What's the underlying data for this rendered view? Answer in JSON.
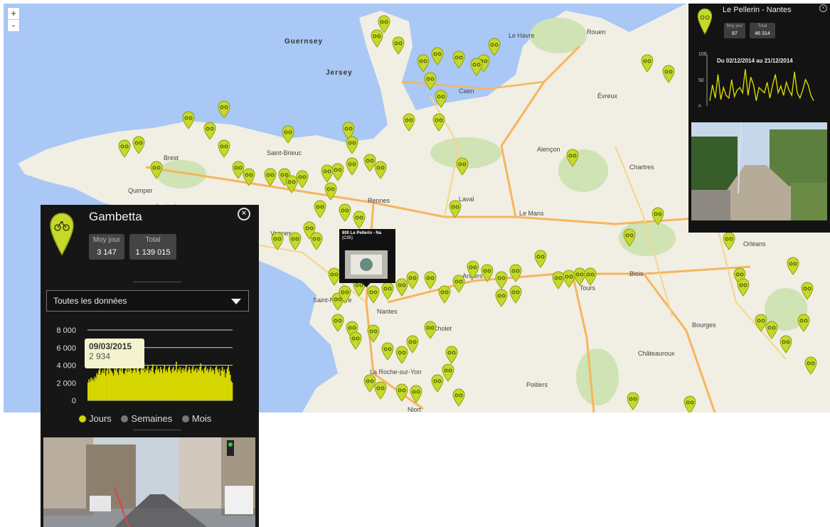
{
  "map": {
    "zoom_in": "+",
    "zoom_out": "-",
    "seas": [
      "Guernsey",
      "Jersey"
    ],
    "places": [
      "Le Havre",
      "Rouen",
      "Caen",
      "Saint-Brieuc",
      "Rennes",
      "Le Mans",
      "Angers",
      "Tours",
      "Nantes",
      "Cholet",
      "La Roche-sur-Yon",
      "Poitiers",
      "Châteauroux",
      "Blois",
      "Orléans",
      "Bourges",
      "Lorient",
      "Vannes",
      "Quimper",
      "Brest",
      "Laval",
      "Évreux",
      "Saint-Nazaire",
      "Alençon",
      "Chartres",
      "Niort"
    ]
  },
  "popup": {
    "title": "800 Le Pellerin - Na",
    "subtitle": "(C95)"
  },
  "panel": {
    "title": "Gambetta",
    "stats": [
      {
        "label": "Moy jour",
        "value": "3 147"
      },
      {
        "label": "Total",
        "value": "1 139 015"
      }
    ],
    "select": "Toutes les données",
    "tooltip": {
      "date": "09/03/2015",
      "value": "2 934"
    },
    "periods": [
      {
        "label": "Jours",
        "selected": true
      },
      {
        "label": "Semaines",
        "selected": false
      },
      {
        "label": "Mois",
        "selected": false
      }
    ],
    "accent": "#d6d600"
  },
  "chart_data": [
    {
      "type": "bar",
      "title": "",
      "ylabel": "",
      "ylim": [
        0,
        8000
      ],
      "ytick_labels": [
        "8 000",
        "6 000",
        "4 000",
        "2 000",
        "0"
      ],
      "series": [
        {
          "values": [
            2000,
            2400,
            2100,
            2600,
            2300,
            2500,
            2200,
            2700,
            2500,
            3100,
            2900,
            3400,
            3800,
            2900,
            3200,
            3500,
            3100,
            3600,
            2800,
            3400,
            4200,
            3000,
            3700,
            3500,
            3300,
            3100,
            2800,
            3600,
            3400,
            3900,
            3200,
            2900,
            3500,
            3600,
            3300,
            3800,
            3100,
            3000,
            3400,
            3700,
            3200,
            3600,
            3300,
            4000,
            3500,
            3100,
            3400,
            3800,
            3500,
            3200,
            3600,
            3900,
            3300,
            3000,
            3500,
            3700,
            3400,
            4300,
            3200,
            3600,
            3400,
            3900,
            3100,
            3500,
            3300,
            3700,
            4100,
            3200,
            3000,
            3500,
            3900,
            3400,
            3600,
            3200,
            3800,
            3500,
            3100,
            3600,
            4000,
            3300,
            3500,
            3200,
            3700,
            3900,
            3400,
            3100,
            3600,
            3800,
            3300,
            3500,
            4400,
            3200,
            3600,
            3400,
            3800,
            3100,
            3500,
            3700,
            3300,
            3600,
            4000,
            3200,
            3400,
            3800,
            3500,
            3100,
            3600,
            3900,
            3300,
            3500,
            3700,
            3200,
            3600,
            3400,
            3800,
            4200,
            3300,
            3500,
            3100,
            3700,
            3900,
            3400,
            3600,
            3200,
            3500,
            3800,
            3300,
            3600,
            3400,
            3000,
            3700,
            3900,
            3500,
            3200,
            3600,
            2800,
            3400,
            3800,
            3300,
            3500,
            2600,
            3100,
            3600,
            3900,
            3300,
            2900,
            2200,
            2000
          ]
        }
      ]
    },
    {
      "type": "line",
      "title": "Du 02/12/2014 au 21/12/2014",
      "ylim": [
        0,
        100
      ],
      "ytick_labels": [
        "100",
        "50",
        "0"
      ],
      "series": [
        {
          "values": [
            10,
            40,
            15,
            60,
            12,
            35,
            20,
            15,
            50,
            18,
            30,
            35,
            25,
            70,
            20,
            55,
            40,
            10,
            35,
            30,
            25,
            45,
            15,
            40,
            60,
            25,
            38,
            20,
            45,
            30,
            20,
            65,
            25,
            15,
            30,
            50,
            40,
            20,
            10
          ]
        }
      ]
    }
  ],
  "panel2": {
    "title": "Le Pellerin - Nantes",
    "stats": [
      {
        "label": "Moy jour",
        "value": "87"
      },
      {
        "label": "Total",
        "value": "46 314"
      }
    ],
    "range": "Du 02/12/2014 au 21/12/2014"
  }
}
